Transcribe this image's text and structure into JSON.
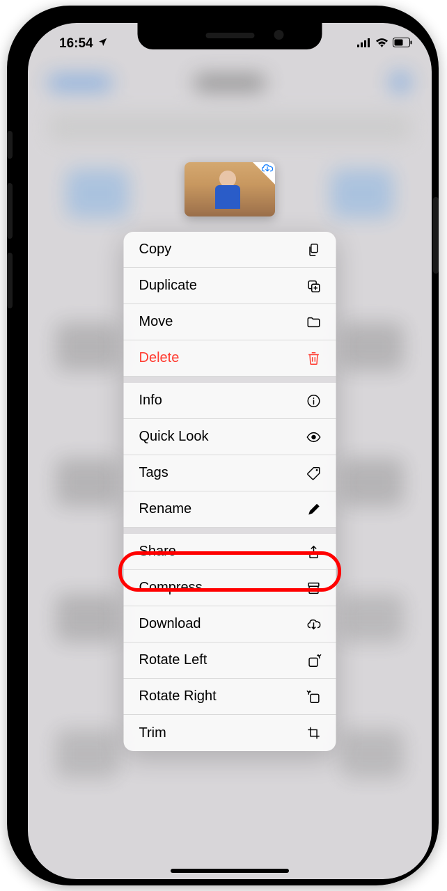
{
  "status": {
    "time": "16:54",
    "location_active": true
  },
  "menu": {
    "copy": "Copy",
    "duplicate": "Duplicate",
    "move": "Move",
    "delete": "Delete",
    "info": "Info",
    "quick_look": "Quick Look",
    "tags": "Tags",
    "rename": "Rename",
    "share": "Share",
    "compress": "Compress",
    "download": "Download",
    "rotate_left": "Rotate Left",
    "rotate_right": "Rotate Right",
    "trim": "Trim"
  },
  "highlighted_item": "compress"
}
